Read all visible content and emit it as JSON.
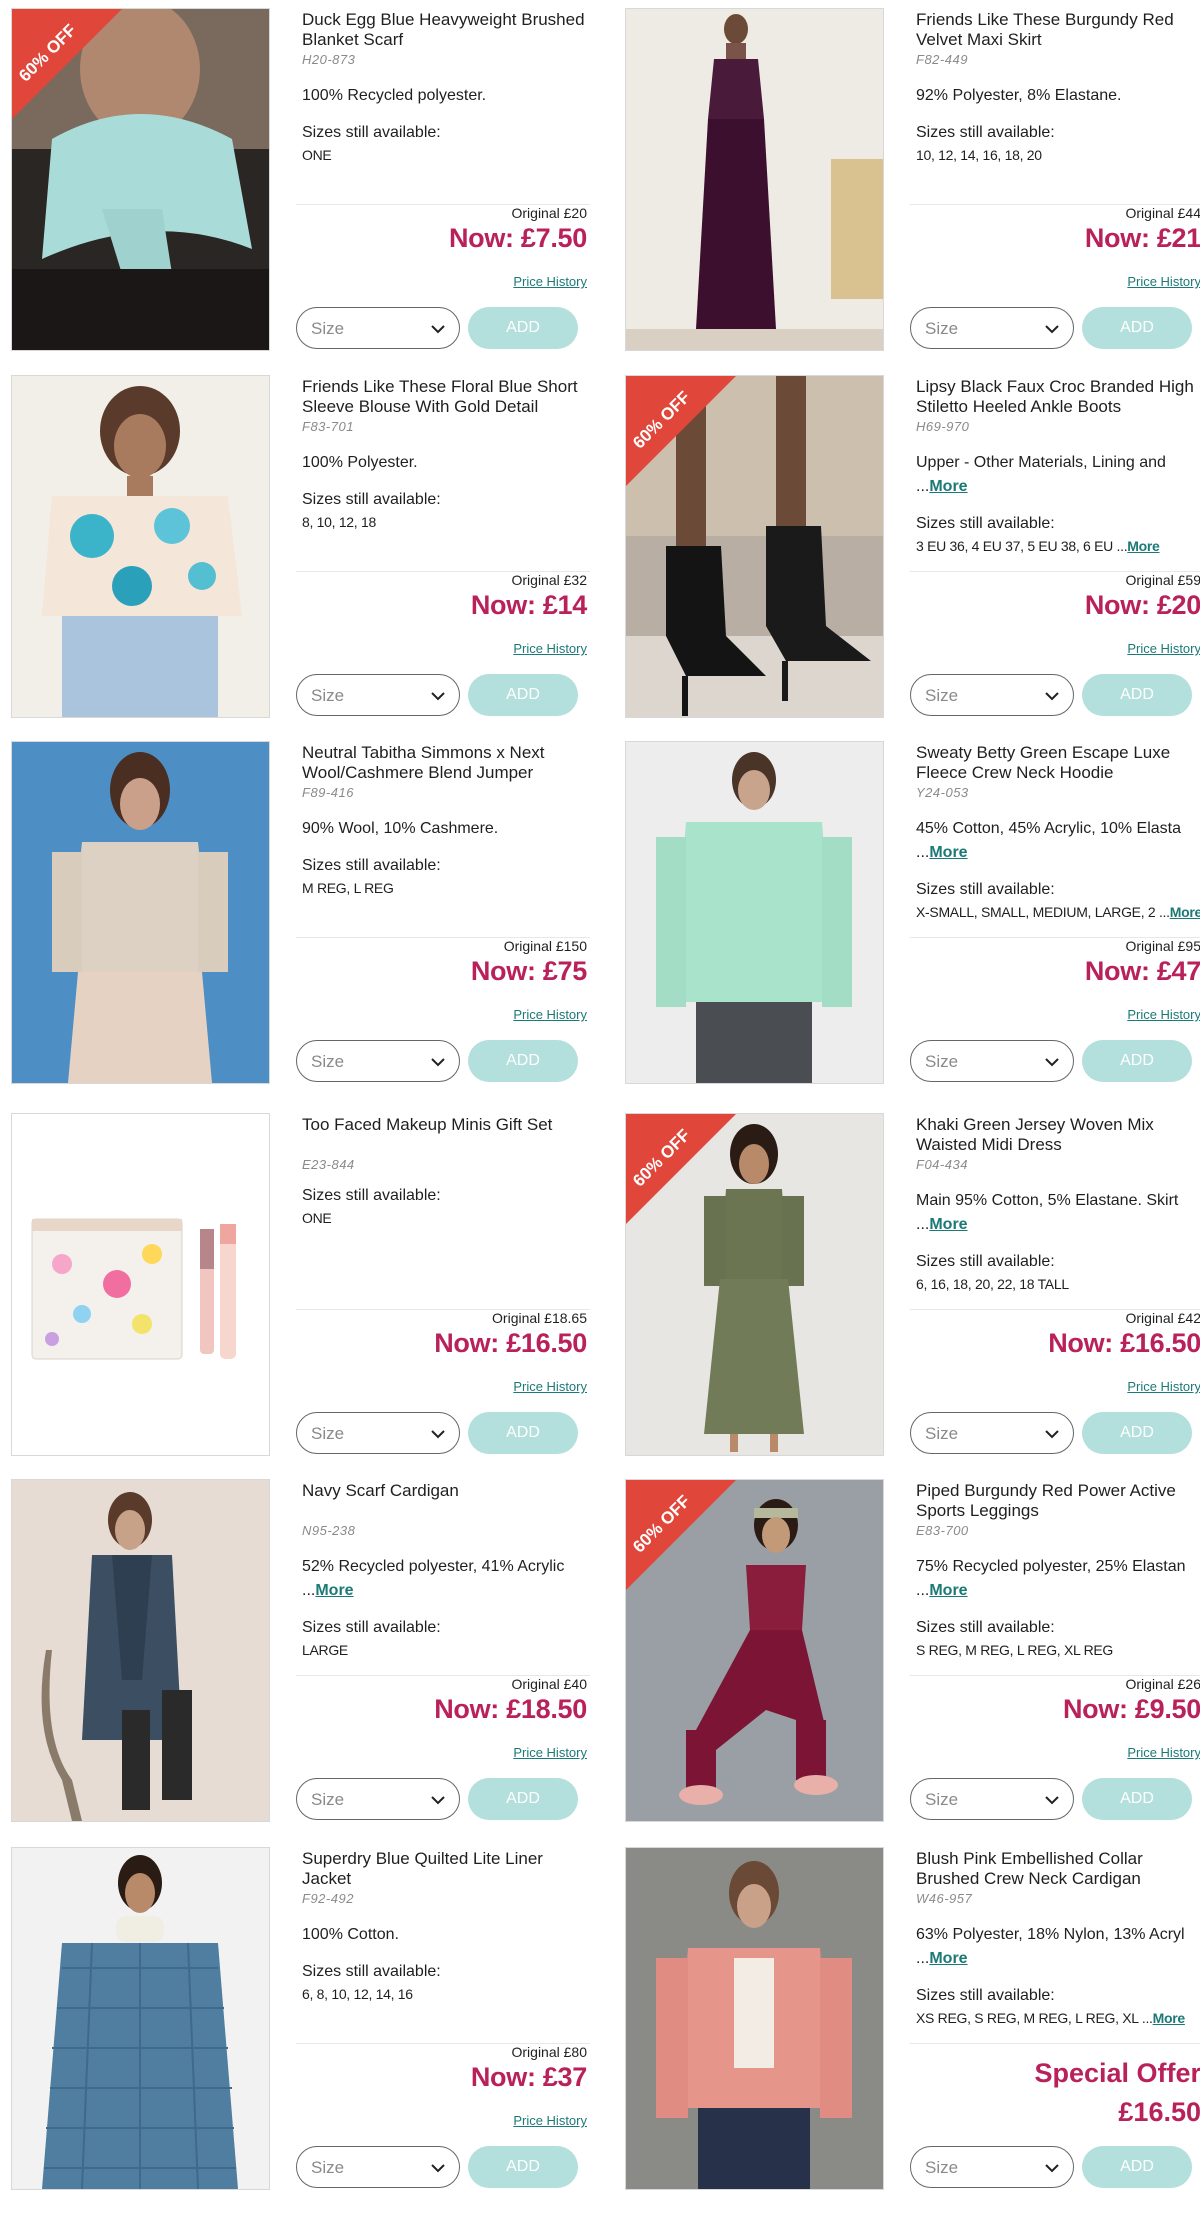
{
  "labels": {
    "sizes_label": "Sizes still available:",
    "price_history": "Price History",
    "size_placeholder": "Size",
    "add": "ADD",
    "badge": "60% OFF"
  },
  "colors": {
    "sale_price": "#b9215a",
    "link": "#1b7a77",
    "add_button": "#b3dfdc",
    "badge": "#e1463a"
  },
  "products": [
    {
      "title": "Duck Egg Blue Heavyweight Brushed Blanket Scarf",
      "code": "H20-873",
      "material": "100% Recycled polyester.",
      "material_more": "",
      "sizes": "ONE",
      "sizes_more": "",
      "original": "Original £20",
      "now": "Now: £7.50",
      "special": "",
      "badge": true,
      "image": "scarf-model-image"
    },
    {
      "title": "Friends Like These Burgundy Red Velvet Maxi Skirt",
      "code": "F82-449",
      "material": "92% Polyester, 8% Elastane.",
      "material_more": "",
      "sizes": "10, 12, 14, 16, 18, 20",
      "sizes_more": "",
      "original": "Original £44",
      "now": "Now: £21",
      "special": "",
      "badge": false,
      "image": "velvet-skirt-model-image"
    },
    {
      "title": "Friends Like These Floral Blue Short Sleeve Blouse With Gold Detail",
      "code": "F83-701",
      "material": "100% Polyester.",
      "material_more": "",
      "sizes": "8, 10, 12, 18",
      "sizes_more": "",
      "original": "Original £32",
      "now": "Now: £14",
      "special": "",
      "badge": false,
      "image": "floral-blouse-model-image"
    },
    {
      "title": "Lipsy Black Faux Croc Branded High Stiletto Heeled Ankle Boots",
      "code": "H69-970",
      "material": "Upper - Other Materials, Lining and ...",
      "material_more": "More",
      "sizes": "3 EU 36, 4 EU 37, 5 EU 38, 6 EU ...",
      "sizes_more": "More",
      "original": "Original £59",
      "now": "Now: £20",
      "special": "",
      "badge": true,
      "image": "ankle-boots-image"
    },
    {
      "title": "Neutral Tabitha Simmons x Next Wool/Cashmere Blend Jumper",
      "code": "F89-416",
      "material": "90% Wool, 10% Cashmere.",
      "material_more": "",
      "sizes": "M REG, L REG",
      "sizes_more": "",
      "original": "Original £150",
      "now": "Now: £75",
      "special": "",
      "badge": false,
      "image": "jumper-model-image"
    },
    {
      "title": "Sweaty Betty Green Escape Luxe Fleece Crew Neck Hoodie",
      "code": "Y24-053",
      "material": "45% Cotton, 45% Acrylic, 10% Elasta ...",
      "material_more": "More",
      "sizes": "X-SMALL, SMALL, MEDIUM, LARGE, 2 ...",
      "sizes_more": "More",
      "original": "Original £95",
      "now": "Now: £47",
      "special": "",
      "badge": false,
      "image": "hoodie-model-image"
    },
    {
      "title": "Too Faced Makeup Minis Gift Set",
      "code": "E23-844",
      "material": "",
      "material_more": "",
      "sizes": "ONE",
      "sizes_more": "",
      "original": "Original £18.65",
      "now": "Now: £16.50",
      "special": "",
      "badge": false,
      "image": "makeup-gift-set-image"
    },
    {
      "title": "Khaki Green Jersey Woven Mix Waisted Midi Dress",
      "code": "F04-434",
      "material": "Main 95% Cotton, 5% Elastane. Skirt ...",
      "material_more": "More",
      "sizes": "6, 16, 18, 20, 22, 18 TALL",
      "sizes_more": "",
      "original": "Original £42",
      "now": "Now: £16.50",
      "special": "",
      "badge": true,
      "image": "midi-dress-model-image"
    },
    {
      "title": "Navy Scarf Cardigan",
      "code": "N95-238",
      "material": "52% Recycled polyester, 41% Acrylic ...",
      "material_more": "More",
      "sizes": "LARGE",
      "sizes_more": "",
      "original": "Original £40",
      "now": "Now: £18.50",
      "special": "",
      "badge": false,
      "image": "scarf-cardigan-model-image"
    },
    {
      "title": "Piped Burgundy Red Power Active Sports Leggings",
      "code": "E83-700",
      "material": "75% Recycled polyester, 25% Elastan ...",
      "material_more": "More",
      "sizes": "S REG, M REG, L REG, XL REG",
      "sizes_more": "",
      "original": "Original £26",
      "now": "Now: £9.50",
      "special": "",
      "badge": true,
      "image": "leggings-model-image"
    },
    {
      "title": "Superdry Blue Quilted Lite Liner Jacket",
      "code": "F92-492",
      "material": "100% Cotton.",
      "material_more": "",
      "sizes": "6, 8, 10, 12, 14, 16",
      "sizes_more": "",
      "original": "Original £80",
      "now": "Now: £37",
      "special": "",
      "badge": false,
      "image": "quilted-jacket-model-image"
    },
    {
      "title": "Blush Pink Embellished Collar Brushed Crew Neck Cardigan",
      "code": "W46-957",
      "material": "63% Polyester, 18% Nylon, 13% Acryl ...",
      "material_more": "More",
      "sizes": "XS REG, S REG, M REG, L REG, XL ...",
      "sizes_more": "More",
      "original": "",
      "now": "£16.50",
      "special": "Special Offer",
      "badge": false,
      "image": "pink-cardigan-model-image"
    }
  ]
}
